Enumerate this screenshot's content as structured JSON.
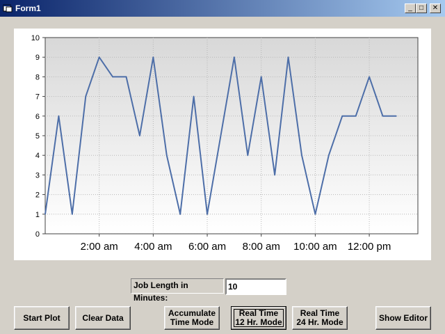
{
  "window": {
    "title": "Form1",
    "minimize_glyph": "_",
    "maximize_glyph": "□",
    "close_glyph": "✕"
  },
  "controls": {
    "job_length_label": "Job Length in Minutes:",
    "job_length_value": "10",
    "start_plot": "Start Plot",
    "clear_data": "Clear Data",
    "accumulate": "Accumulate\nTime Mode",
    "real12": "Real Time\n12 Hr. Mode",
    "real24": "Real Time\n24 Hr. Mode",
    "show_editor": "Show Editor"
  },
  "chart_data": {
    "type": "line",
    "ylim": [
      0,
      10
    ],
    "yticks": [
      0,
      1,
      2,
      3,
      4,
      5,
      6,
      7,
      8,
      9,
      10
    ],
    "xlim_hours": [
      0,
      13.8
    ],
    "xticks": [
      {
        "hour": 2,
        "label": "2:00 am"
      },
      {
        "hour": 4,
        "label": "4:00 am"
      },
      {
        "hour": 6,
        "label": "6:00 am"
      },
      {
        "hour": 8,
        "label": "8:00 am"
      },
      {
        "hour": 10,
        "label": "10:00 am"
      },
      {
        "hour": 12,
        "label": "12:00 pm"
      }
    ],
    "x_hours": [
      0.0,
      0.5,
      1.0,
      1.5,
      2.0,
      2.5,
      3.0,
      3.5,
      4.0,
      4.5,
      5.0,
      5.5,
      6.0,
      6.5,
      7.0,
      7.5,
      8.0,
      8.5,
      9.0,
      9.5,
      10.0,
      10.5,
      11.0,
      11.5,
      12.0,
      12.5,
      13.0
    ],
    "values": [
      1,
      6,
      1,
      7,
      9,
      8,
      8,
      5,
      9,
      4,
      1,
      7,
      1,
      5,
      9,
      4,
      8,
      3,
      9,
      4,
      1,
      4,
      6,
      6,
      8,
      6,
      6
    ],
    "line_color": "#4d6ea8",
    "grid": true
  }
}
